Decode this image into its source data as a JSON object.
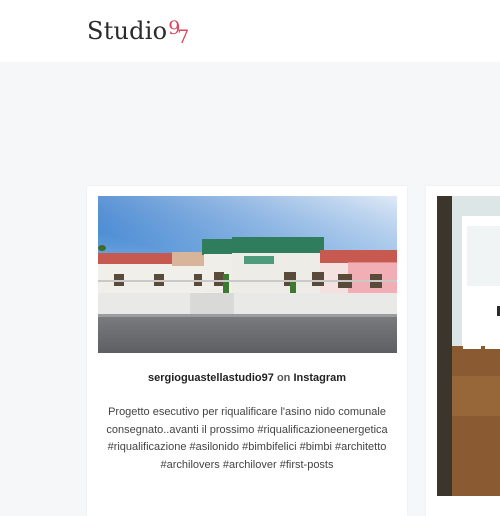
{
  "brand": {
    "word": "Studio",
    "digit1": "9",
    "digit2": "7",
    "accent_color": "#d9465f"
  },
  "feed": {
    "posts": [
      {
        "username": "sergioguastellastudio97",
        "on_text": "on",
        "platform": "Instagram",
        "caption": "Progetto esecutivo per riqualificare l'asino nido comunale consegnato..avanti il prossimo #riqualificazioneenergetica #riqualificazione #asilonido #bimbifelici #bimbi #architetto #archilovers #archilover #first-posts"
      }
    ]
  }
}
